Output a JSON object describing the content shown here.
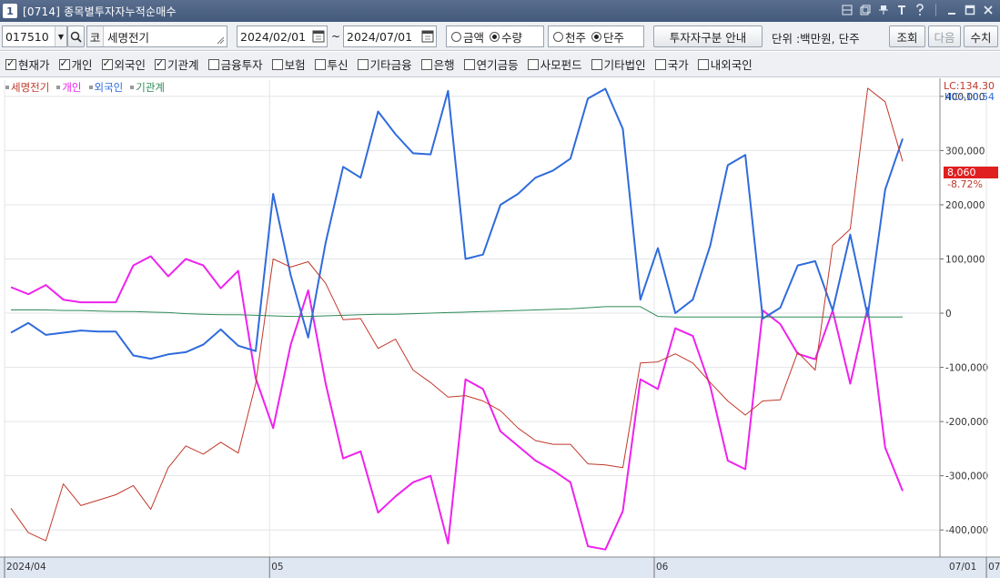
{
  "window": {
    "number": "1",
    "title": "[0714] 종목별투자자누적순매수",
    "title_icons": [
      "layout-icon",
      "copy-icon",
      "pin-icon",
      "text-icon",
      "help-icon",
      "minimize-icon",
      "maximize-icon",
      "close-icon"
    ]
  },
  "toolbar": {
    "stock_code": "017510",
    "code_prefix": "코",
    "stock_name": "세명전기",
    "date_from": "2024/02/01",
    "date_sep": "~",
    "date_to": "2024/07/01",
    "mode_options": [
      {
        "label": "금액",
        "selected": false
      },
      {
        "label": "수량",
        "selected": true
      }
    ],
    "unit_options": [
      {
        "label": "천주",
        "selected": false
      },
      {
        "label": "단주",
        "selected": true
      }
    ],
    "investor_info_button": "투자자구분 안내",
    "unit_text": "단위 :백만원, 단주",
    "query_button": "조회",
    "next_button": "다음",
    "receive_button": "수치"
  },
  "filters": [
    {
      "label": "현재가",
      "checked": true
    },
    {
      "label": "개인",
      "checked": true
    },
    {
      "label": "외국인",
      "checked": true
    },
    {
      "label": "기관계",
      "checked": true
    },
    {
      "label": "금융투자",
      "checked": false
    },
    {
      "label": "보험",
      "checked": false
    },
    {
      "label": "투신",
      "checked": false
    },
    {
      "label": "기타금융",
      "checked": false
    },
    {
      "label": "은행",
      "checked": false
    },
    {
      "label": "연기금등",
      "checked": false
    },
    {
      "label": "사모펀드",
      "checked": false
    },
    {
      "label": "기타법인",
      "checked": false
    },
    {
      "label": "국가",
      "checked": false
    },
    {
      "label": "내외국인",
      "checked": false
    }
  ],
  "legend": [
    {
      "label": "세명전기",
      "color": "#c0392b"
    },
    {
      "label": "개인",
      "color": "#ee22ee"
    },
    {
      "label": "외국인",
      "color": "#2f6bdc"
    },
    {
      "label": "기관계",
      "color": "#2e8b57"
    }
  ],
  "price_info": {
    "lc": "LC:134.30",
    "hc": "HC:-10.54",
    "current": "8,060",
    "change": "-8.72%"
  },
  "chart_data": {
    "type": "line",
    "y_ticks": [
      "400,000",
      "300,000",
      "200,000",
      "100,000",
      "0",
      "-100,000",
      "-200,000",
      "-300,000",
      "-400,000"
    ],
    "ylim": [
      -450000,
      430000
    ],
    "x_labels": [
      "2024/04",
      "05",
      "06",
      "07"
    ],
    "x_label_index": [
      0,
      15,
      37,
      56
    ],
    "last_date_label": "07/01",
    "series": [
      {
        "name": "개인",
        "color": "#ee22ee",
        "values": [
          48000,
          35000,
          52000,
          25000,
          20000,
          20000,
          20000,
          88000,
          105000,
          68000,
          100000,
          88000,
          46000,
          78000,
          -120000,
          -212000,
          -58000,
          42000,
          -130000,
          -268000,
          -255000,
          -368000,
          -338000,
          -312000,
          -300000,
          -425000,
          -122000,
          -140000,
          -218000,
          -245000,
          -272000,
          -290000,
          -312000,
          -430000,
          -436000,
          -365000,
          -122000,
          -140000,
          -28000,
          -42000,
          -135000,
          -272000,
          -288000,
          5000,
          -20000,
          -75000,
          -85000,
          5000,
          -130000,
          10000,
          -248000,
          -328000
        ]
      },
      {
        "name": "외국인",
        "color": "#2f6bdc",
        "values": [
          -36000,
          -18000,
          -40000,
          -36000,
          -32000,
          -34000,
          -34000,
          -78000,
          -84000,
          -76000,
          -72000,
          -58000,
          -30000,
          -60000,
          -70000,
          220000,
          70000,
          -45000,
          130000,
          270000,
          250000,
          372000,
          330000,
          295000,
          293000,
          410000,
          100000,
          108000,
          200000,
          220000,
          250000,
          263000,
          285000,
          396000,
          414000,
          340000,
          25000,
          120000,
          0,
          25000,
          125000,
          273000,
          292000,
          -10000,
          10000,
          88000,
          96000,
          5000,
          145000,
          -5000,
          228000,
          322000
        ]
      },
      {
        "name": "기관계",
        "color": "#2e8b57",
        "values": [
          6000,
          6000,
          6000,
          5000,
          5000,
          4000,
          3000,
          3000,
          2000,
          1000,
          -1000,
          -2000,
          -3000,
          -3000,
          -4000,
          -5000,
          -6000,
          -6000,
          -5000,
          -4000,
          -3000,
          -2000,
          -2000,
          -1000,
          0,
          1000,
          2000,
          3000,
          4000,
          5000,
          6000,
          7000,
          8000,
          10000,
          12000,
          12000,
          12000,
          -6000,
          -7000,
          -7000,
          -7000,
          -7000,
          -7000,
          -7000,
          -7000,
          -7000,
          -7000,
          -7000,
          -7000,
          -7000,
          -7000,
          -7000
        ]
      },
      {
        "name": "세명전기",
        "color": "#c0392b",
        "values": [
          -360000,
          -405000,
          -420000,
          -315000,
          -355000,
          -345000,
          -335000,
          -318000,
          -362000,
          -285000,
          -245000,
          -260000,
          -238000,
          -258000,
          -130000,
          100000,
          85000,
          95000,
          55000,
          -12000,
          -10000,
          -65000,
          -48000,
          -105000,
          -128000,
          -155000,
          -152000,
          -162000,
          -180000,
          -212000,
          -235000,
          -242000,
          -242000,
          -278000,
          -280000,
          -285000,
          -92000,
          -90000,
          -75000,
          -92000,
          -128000,
          -162000,
          -188000,
          -162000,
          -160000,
          -72000,
          -105000,
          125000,
          155000,
          415000,
          390000,
          280000
        ]
      }
    ]
  }
}
